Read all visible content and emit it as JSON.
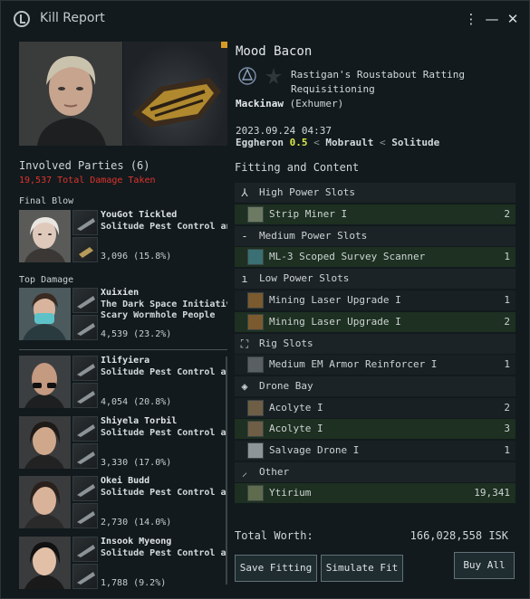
{
  "window": {
    "title": "Kill Report",
    "icon": "kill-report-icon"
  },
  "victim": {
    "name": "Mood Bacon",
    "corporation": "Rastigan's Roustabout Ratting Requisitioning",
    "ship_name": "Mackinaw",
    "ship_class": "(Exhumer)",
    "datetime": "2023.09.24 04:37",
    "system": "Eggheron",
    "security": "0.5",
    "constellation": "Mobrault",
    "region": "Solitude",
    "separator": "<"
  },
  "involved": {
    "title": "Involved Parties (6)",
    "total_damage": "19,537 Total Damage Taken",
    "final_blow_label": "Final Blow",
    "top_damage_label": "Top Damage",
    "final_blow": {
      "name": "YouGot Tickled",
      "corp": "Solitude Pest Control and",
      "damage": "3,096 (15.8%)"
    },
    "top_damage": {
      "name": "Xuixien",
      "corp": "The Dark Space Initiative",
      "alliance": "Scary Wormhole People",
      "damage": "4,539 (23.2%)"
    },
    "list": [
      {
        "name": "Ilifyiera",
        "corp": "Solitude Pest Control and",
        "damage": "4,054 (20.8%)"
      },
      {
        "name": "Shiyela Torbil",
        "corp": "Solitude Pest Control and",
        "damage": "3,330 (17.0%)"
      },
      {
        "name": "Okei Budd",
        "corp": "Solitude Pest Control and",
        "damage": "2,730 (14.0%)"
      },
      {
        "name": "Insook Myeong",
        "corp": "Solitude Pest Control and",
        "damage": "1,788 (9.2%)"
      }
    ]
  },
  "fitting": {
    "title": "Fitting and Content",
    "high_power": "High Power Slots",
    "strip_miner": {
      "name": "Strip Miner I",
      "qty": "2"
    },
    "medium_power": "Medium Power Slots",
    "scanner": {
      "name": "ML-3 Scoped Survey Scanner",
      "qty": "1"
    },
    "low_power": "Low Power Slots",
    "mlu_a": {
      "name": "Mining Laser Upgrade I",
      "qty": "1"
    },
    "mlu_b": {
      "name": "Mining Laser Upgrade I",
      "qty": "2"
    },
    "rig_slots": "Rig Slots",
    "rig": {
      "name": "Medium EM Armor Reinforcer I",
      "qty": "1"
    },
    "drone_bay": "Drone Bay",
    "acolyte_a": {
      "name": "Acolyte I",
      "qty": "2"
    },
    "acolyte_b": {
      "name": "Acolyte I",
      "qty": "3"
    },
    "salvage": {
      "name": "Salvage Drone I",
      "qty": "1"
    },
    "other": "Other",
    "ytirium": {
      "name": "Ytirium",
      "qty": "19,341"
    }
  },
  "total_worth_label": "Total Worth:",
  "total_worth_value": "166,028,558 ISK",
  "buttons": {
    "save_fitting": "Save Fitting",
    "simulate_fit": "Simulate Fit",
    "buy_all": "Buy All"
  },
  "colors": {
    "security": "#d9e84a",
    "damage_text": "#e0332c",
    "dropped_row": "#1d3021",
    "destroyed_row": "#182023"
  }
}
